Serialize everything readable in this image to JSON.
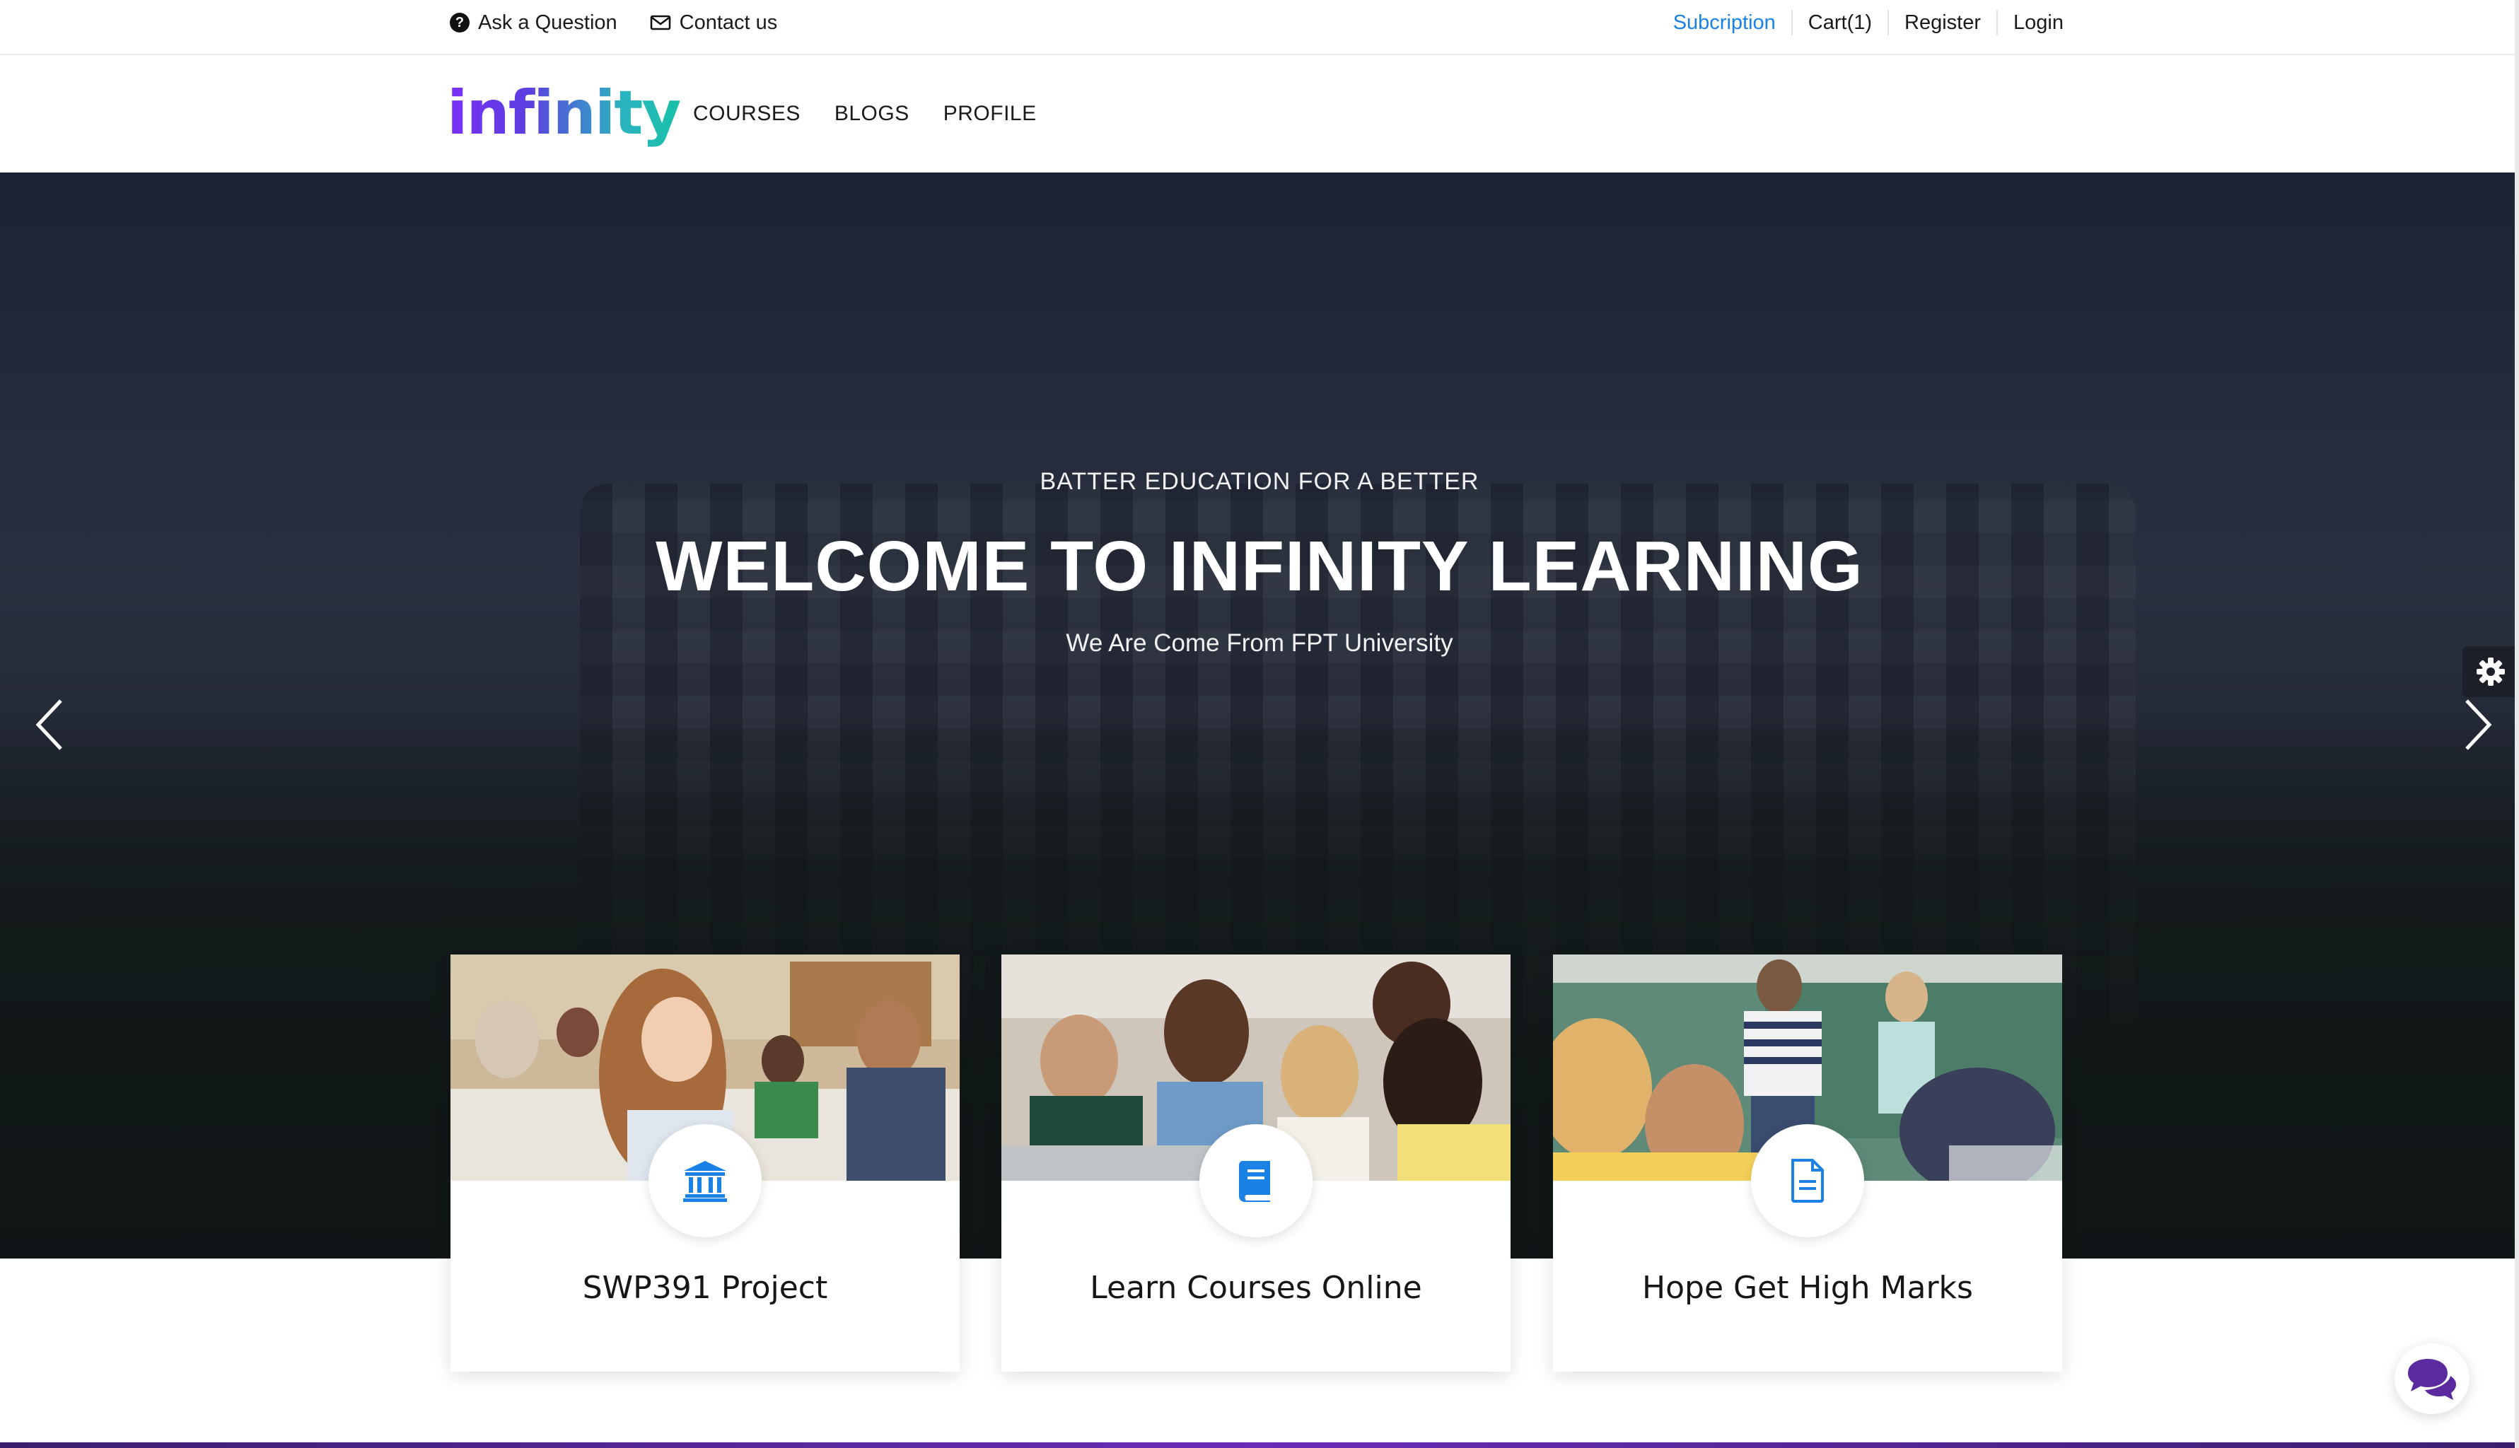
{
  "topbar": {
    "ask_label": "Ask a Question",
    "contact_label": "Contact us",
    "subscription_label": "Subcription",
    "cart_label": "Cart(1)",
    "register_label": "Register",
    "login_label": "Login",
    "accent_color": "#1a82e6"
  },
  "nav": {
    "logo_text": "infinity",
    "items": [
      "COURSES",
      "BLOGS",
      "PROFILE"
    ]
  },
  "hero": {
    "subtitle": "BATTER EDUCATION FOR A BETTER",
    "title": "WELCOME TO INFINITY LEARNING",
    "description": "We Are Come From FPT University"
  },
  "cards": [
    {
      "title": "SWP391 Project",
      "icon": "institution-icon"
    },
    {
      "title": "Learn Courses Online",
      "icon": "book-icon"
    },
    {
      "title": "Hope Get High Marks",
      "icon": "document-icon"
    }
  ],
  "colors": {
    "icon_blue": "#1a82e6",
    "chat_purple": "#5b2a9e"
  }
}
